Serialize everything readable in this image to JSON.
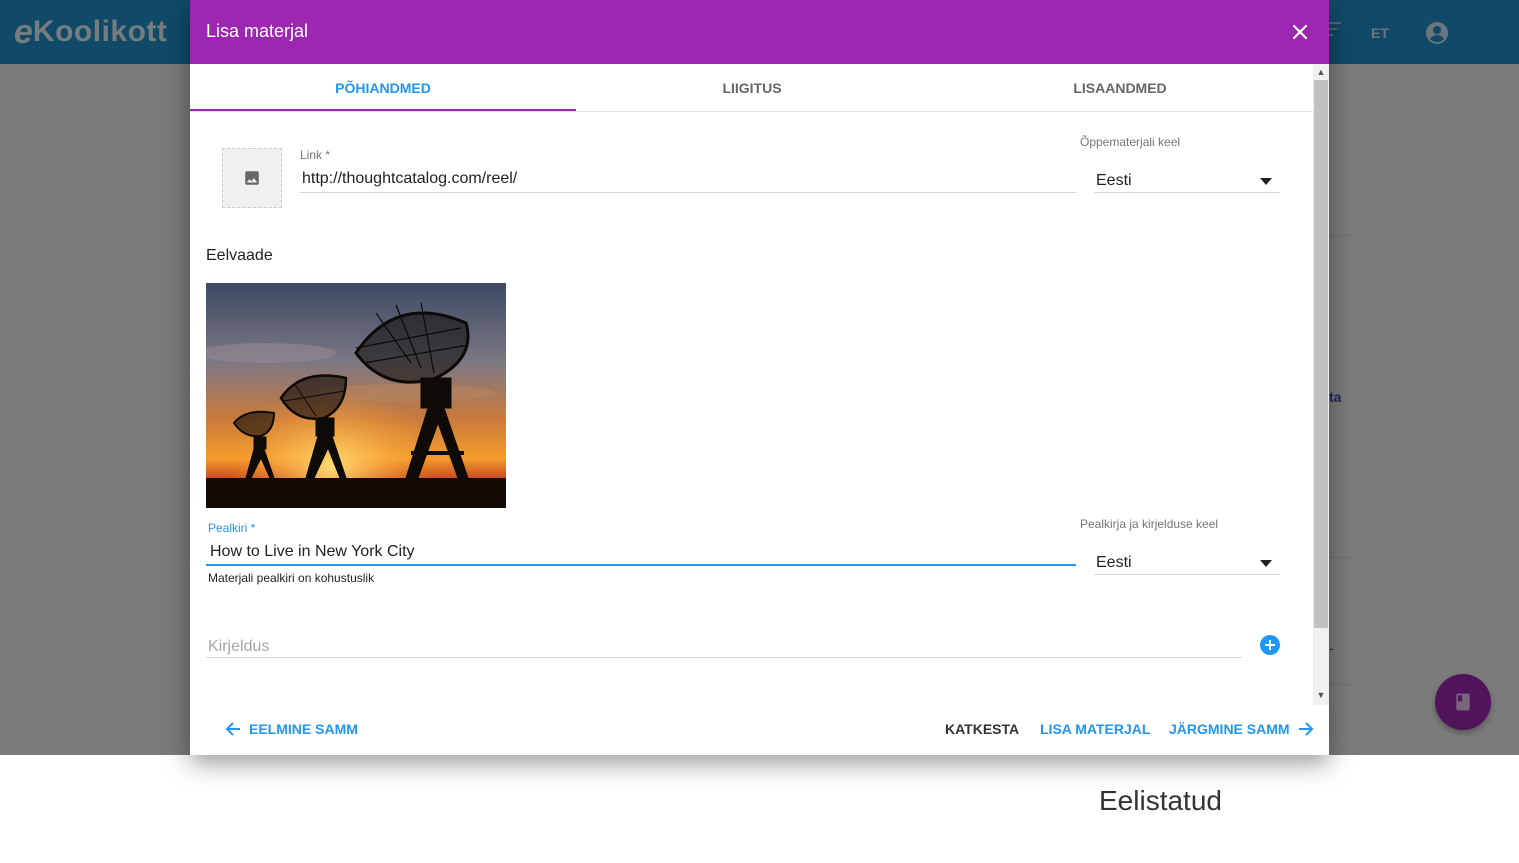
{
  "app": {
    "logo": {
      "prefix": "e",
      "name": "Koolikott"
    },
    "language": "ET",
    "bg_link_text": "ta",
    "bg_dash": "-",
    "featured_title": "Eelistatud"
  },
  "dialog": {
    "title": "Lisa materjal",
    "tabs": [
      {
        "label": "PÕHIANDMED",
        "active": true
      },
      {
        "label": "LIIGITUS",
        "active": false
      },
      {
        "label": "LISAANDMED",
        "active": false
      }
    ],
    "link": {
      "label": "Link *",
      "value": "http://thoughtcatalog.com/reel/"
    },
    "material_language": {
      "label": "Õppematerjali keel",
      "value": "Eesti"
    },
    "preview": {
      "label": "Eelvaade"
    },
    "title_field": {
      "label": "Pealkiri *",
      "value": "How to Live in New York City",
      "hint": "Materjali pealkiri on kohustuslik"
    },
    "title_language": {
      "label": "Pealkirja ja kirjelduse keel",
      "value": "Eesti"
    },
    "description": {
      "placeholder": "Kirjeldus"
    },
    "buttons": {
      "previous": "EELMINE SAMM",
      "cancel": "KATKESTA",
      "add": "LISA MATERJAL",
      "next": "JÄRGMINE SAMM"
    }
  },
  "colors": {
    "primary": "#9c27b0",
    "accent": "#2196f3",
    "header": "#1f8fc7"
  },
  "icons": [
    "close-icon",
    "image-icon",
    "arrow-left-icon",
    "arrow-right-icon",
    "add-circle-icon",
    "account-icon",
    "sort-icon",
    "book-icon"
  ]
}
